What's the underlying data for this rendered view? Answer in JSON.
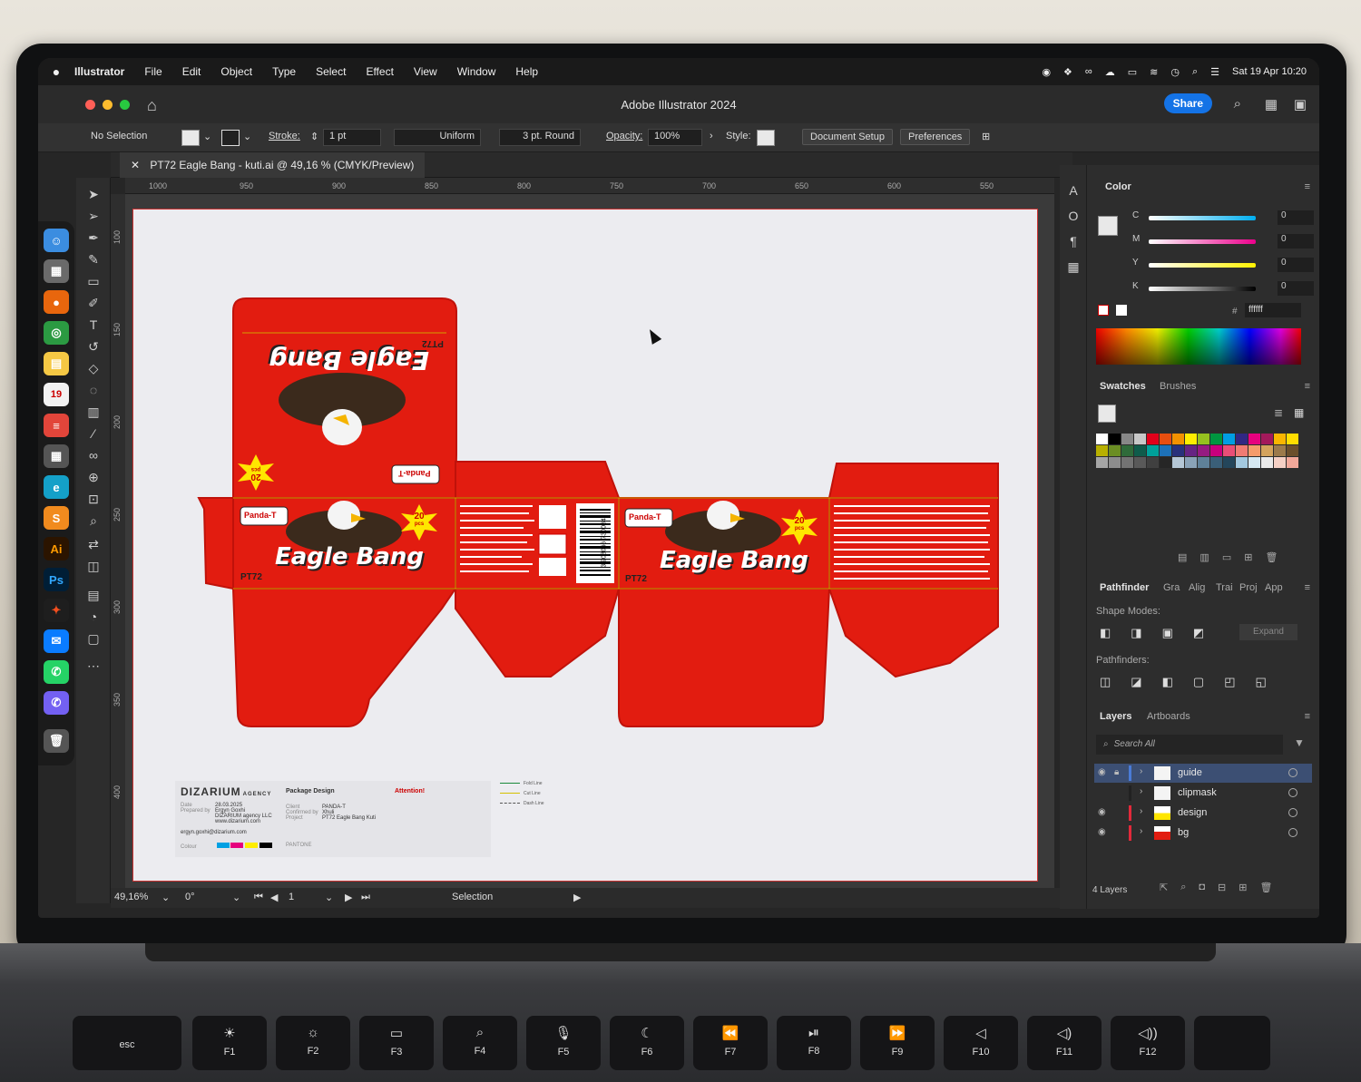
{
  "menubar": {
    "app_name": "Illustrator",
    "items": [
      "File",
      "Edit",
      "Object",
      "Type",
      "Select",
      "Effect",
      "View",
      "Window",
      "Help"
    ],
    "clock": "Sat 19 Apr  10:20"
  },
  "window": {
    "title": "Adobe Illustrator 2024",
    "share_label": "Share"
  },
  "control_bar": {
    "selection_label": "No Selection",
    "stroke_label": "Stroke:",
    "stroke_value": "1 pt",
    "profile_label": "Uniform",
    "brush_label": "3 pt. Round",
    "opacity_label": "Opacity:",
    "opacity_value": "100%",
    "style_label": "Style:",
    "document_setup_label": "Document Setup",
    "preferences_label": "Preferences"
  },
  "document_tab": {
    "label": "PT72 Eagle Bang - kuti.ai @ 49,16 % (CMYK/Preview)"
  },
  "ruler": {
    "h_ticks": [
      "1000",
      "950",
      "900",
      "850",
      "800",
      "750",
      "700",
      "650",
      "600",
      "550"
    ],
    "v_ticks": [
      "100",
      "150",
      "200",
      "250",
      "300",
      "350",
      "400"
    ]
  },
  "artwork": {
    "product_code": "PT72",
    "title_line1": "Eagle",
    "title_line2": "Bang",
    "count_number": "20",
    "count_unit": "pcs",
    "brand": "Panda-T",
    "barcode_number": "3 908066 730084",
    "colors": {
      "box_red": "#e21c10",
      "box_dark_red": "#c0120a",
      "badge_yellow": "#ffe600"
    }
  },
  "info_panel": {
    "agency": "DIZARIUM",
    "agency_suffix": "AGENCY",
    "section": "Package Design",
    "attention": "Attention!",
    "legend": [
      "Fold Line",
      "Cut Line",
      "Dash Line"
    ],
    "rows_left": [
      {
        "k": "Date",
        "v": "28.03.2025"
      },
      {
        "k": "Prepared by",
        "v": "Ergyn Goxhi"
      },
      {
        "k": "",
        "v": "DIZARIUM agency LLC"
      },
      {
        "k": "",
        "v": "www.dizarium.com"
      },
      {
        "k": "",
        "v": "ergyn.goxhi@dizarium.com"
      }
    ],
    "rows_mid": [
      {
        "k": "Client",
        "v": "PANDA-T"
      },
      {
        "k": "Confirmed by",
        "v": "Xhuli"
      },
      {
        "k": "Project",
        "v": "PT72 Eagle Bang Kuti"
      }
    ],
    "colour_label": "Colour",
    "pantone_label": "PANTONE"
  },
  "status_bar": {
    "zoom": "49,16%",
    "rotation": "0°",
    "artboard_number": "1",
    "tool": "Selection"
  },
  "color_panel": {
    "title": "Color",
    "channels": [
      {
        "label": "C",
        "value": "0",
        "unit": "%"
      },
      {
        "label": "M",
        "value": "0",
        "unit": "%"
      },
      {
        "label": "Y",
        "value": "0",
        "unit": "%"
      },
      {
        "label": "K",
        "value": "0",
        "unit": "%"
      }
    ],
    "hex_symbol": "#",
    "hex_value": "ffffff"
  },
  "swatches_panel": {
    "tabs": [
      "Swatches",
      "Brushes"
    ],
    "colors": [
      "#ffffff",
      "#000000",
      "#888888",
      "#c8c8c8",
      "#e2001a",
      "#e84e0f",
      "#f39200",
      "#ffed00",
      "#95c11f",
      "#009640",
      "#009ee3",
      "#312783",
      "#e6007e",
      "#a3195b",
      "#fab600",
      "#ffdd00",
      "#b8b000",
      "#6b8e23",
      "#2f6b3a",
      "#0f5c4b",
      "#00a19a",
      "#1d71b8",
      "#28317b",
      "#662483",
      "#951b81",
      "#c8007d",
      "#e94e77",
      "#f07b73",
      "#f49b6b",
      "#d4a35c",
      "#9c7a4b",
      "#6b4f2c",
      "#a6a6a6",
      "#8c8c8c",
      "#737373",
      "#595959",
      "#404040",
      "#262626",
      "#b5c7d6",
      "#8aa3b8",
      "#5f8199",
      "#3a5f78",
      "#24465b",
      "#a3c9e0",
      "#d6e8f2",
      "#eaeaea",
      "#f5d0c5",
      "#f2a89a"
    ]
  },
  "pathfinder_panel": {
    "tabs": [
      "Pathfinder",
      "Gra",
      "Alig",
      "Trai",
      "Proj",
      "App"
    ],
    "shape_modes_label": "Shape Modes:",
    "expand_label": "Expand",
    "pathfinders_label": "Pathfinders:"
  },
  "layers_panel": {
    "tabs": [
      "Layers",
      "Artboards"
    ],
    "search_placeholder": "Search All",
    "layers": [
      {
        "name": "guide",
        "color": "#4a7bd6"
      },
      {
        "name": "clipmask",
        "color": "#222222"
      },
      {
        "name": "design",
        "color": "#e2293a"
      },
      {
        "name": "bg",
        "color": "#e2293a"
      }
    ],
    "count_label": "4 Layers"
  },
  "keyboard": {
    "keys": [
      "esc",
      "F1",
      "F2",
      "F3",
      "F4",
      "F5",
      "F6",
      "F7",
      "F8",
      "F9",
      "F10",
      "F11",
      "F12"
    ]
  }
}
